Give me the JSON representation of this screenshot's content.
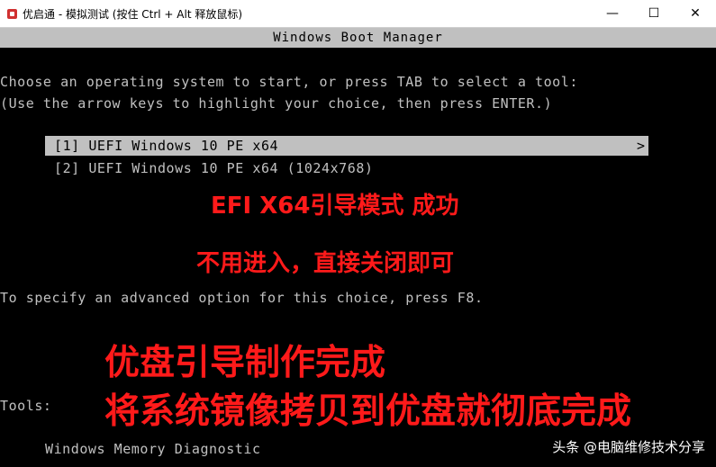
{
  "window": {
    "title": "优启通 - 模拟测试 (按住 Ctrl + Alt 释放鼠标)",
    "minimize_glyph": "—",
    "maximize_glyph": "☐",
    "close_glyph": "✕"
  },
  "boot": {
    "header": "Windows Boot Manager",
    "prompt_line1": "Choose an operating system to start, or press TAB to select a tool:",
    "prompt_line2": "(Use the arrow keys to highlight your choice, then press ENTER.)",
    "entries": [
      {
        "label": "[1] UEFI Windows 10 PE x64",
        "selected": true
      },
      {
        "label": "[2] UEFI Windows 10 PE x64 (1024x768)",
        "selected": false
      }
    ],
    "selected_arrow": ">",
    "advanced_hint": "To specify an advanced option for this choice, press F8.",
    "tools_label": "Tools:",
    "tools": [
      "Windows Memory Diagnostic"
    ]
  },
  "annotations": {
    "line1": "EFI X64引导模式  成功",
    "line2": "不用进入，直接关闭即可",
    "line3": "优盘引导制作完成",
    "line4": "将系统镜像拷贝到优盘就彻底完成"
  },
  "watermark": "头条 @电脑维修技术分享",
  "colors": {
    "annotation_red": "#ff1a1a",
    "console_text": "#c0c0c0",
    "highlight_bg": "#c0c0c0"
  }
}
